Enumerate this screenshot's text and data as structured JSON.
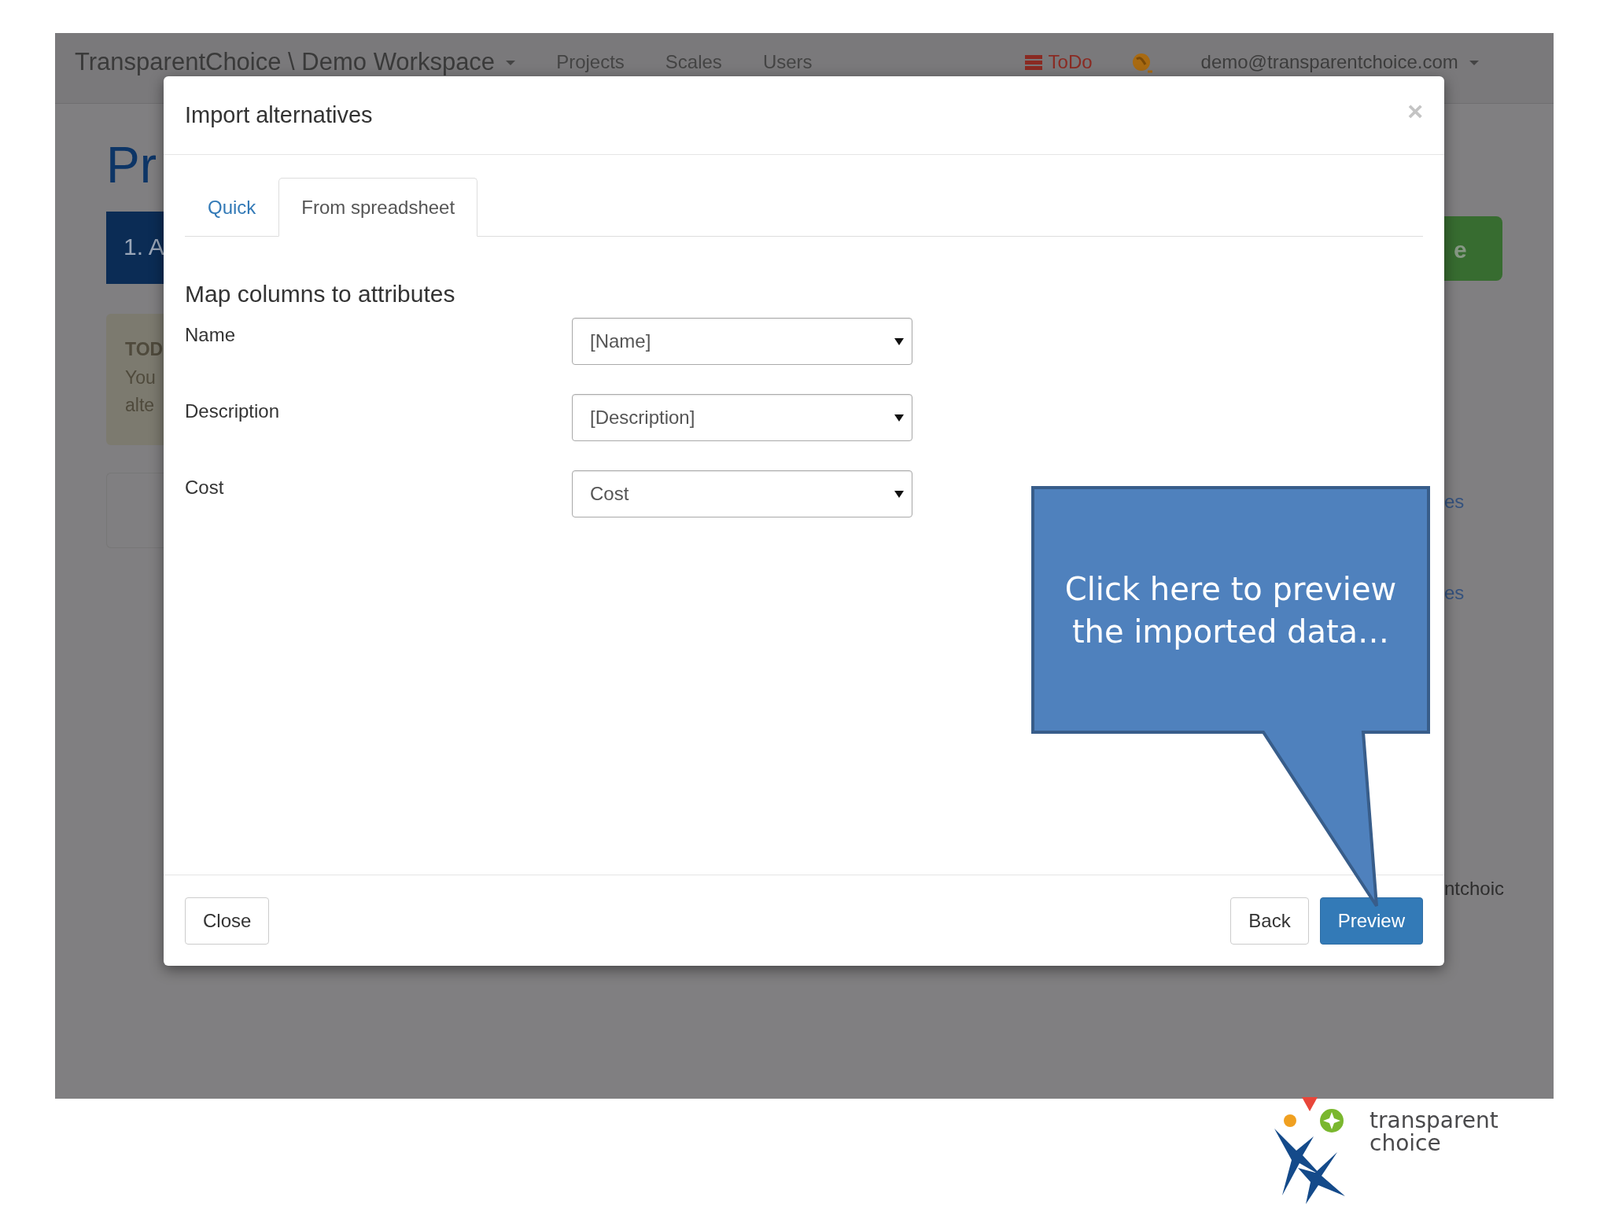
{
  "app": {
    "navbar": {
      "brand": "TransparentChoice \\ Demo Workspace",
      "links": [
        "Projects",
        "Scales",
        "Users"
      ],
      "todo": "ToDo",
      "user": "demo@transparentchoice.com"
    },
    "page_title": "Pr",
    "step_button": "1. A",
    "todo_box": {
      "title": "TOD",
      "lines": [
        "You",
        "alte"
      ]
    },
    "green_button": "e",
    "side_links": [
      "es",
      "es"
    ],
    "footer_text": "ntchoic"
  },
  "modal": {
    "title": "Import alternatives",
    "close": "×",
    "tabs": [
      {
        "label": "Quick",
        "selected": false
      },
      {
        "label": "From spreadsheet",
        "selected": true
      }
    ],
    "section_title": "Map columns to attributes",
    "mappings": [
      {
        "label": "Name",
        "value": "[Name]"
      },
      {
        "label": "Description",
        "value": "[Description]"
      },
      {
        "label": "Cost",
        "value": "Cost"
      }
    ],
    "buttons_left": [
      {
        "label": "Close",
        "kind": "default"
      }
    ],
    "buttons_right": [
      {
        "label": "Back",
        "kind": "default"
      },
      {
        "label": "Preview",
        "kind": "primary"
      }
    ]
  },
  "callout": {
    "lines": [
      "Click here to preview",
      "the imported data…"
    ]
  },
  "logo": {
    "lines": [
      "transparent",
      "choice"
    ]
  }
}
